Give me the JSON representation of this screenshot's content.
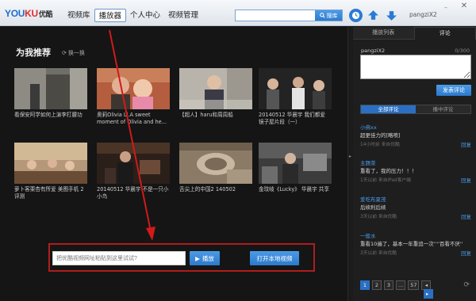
{
  "logo": {
    "you": "YOU",
    "ku": "KU",
    "cn": "优酷"
  },
  "nav": [
    "视频库",
    "播放器",
    "个人中心",
    "视频管理"
  ],
  "search": {
    "placeholder": "",
    "button": "搜库"
  },
  "user": {
    "name": "pangziX2"
  },
  "section": {
    "title": "为我推荐",
    "refresh": "换一换"
  },
  "videos": [
    {
      "title": "看保安阿学如何上演李打腰功"
    },
    {
      "title": "奥莉Olivia Li.A sweet moment of Olivia and he..."
    },
    {
      "title": "【超人】haru和周周船"
    },
    {
      "title": "20140512 华晨宇 我们都爱 镜子屋片段（一）"
    },
    {
      "title": "萝卜客栗杏有所爱 美图手机 2评测"
    },
    {
      "title": "20140512 华晨宇 不是一只小 小鸟"
    },
    {
      "title": "舌尖上的中国2 140502"
    },
    {
      "title": "金玟岐《Lucky》 华晨宇 共享"
    }
  ],
  "player": {
    "url_placeholder": "把优酷视频网址粘贴到这里试试?",
    "play": "播放",
    "local": "打开本地视频"
  },
  "panel": {
    "tabs": [
      "播放列表",
      "评论"
    ],
    "comment_user": "pangziX2",
    "char_count": "0/300",
    "submit": "发表评论",
    "filter_tabs": [
      "全部评论",
      "播中评论"
    ],
    "comments": [
      {
        "user": "小佛xx",
        "body": "超更佳力的[略喷]",
        "meta": "14小时前 来自优酷",
        "reply": "回复"
      },
      {
        "user": "主題菜",
        "body": "重看了，我的压力！！！",
        "meta": "1天以前 来自iPad客户端",
        "reply": "回复"
      },
      {
        "user": "爱吃布夏茂",
        "body": "后续利后续",
        "meta": "3天以前 来自优酷",
        "reply": "回复"
      },
      {
        "user": "一般水",
        "body": "重看10遍了，基本一年重追一次''''百看不厌''",
        "meta": "3天以前 来自优酷",
        "reply": "回复"
      }
    ],
    "pages": [
      "1",
      "2",
      "3",
      "...",
      "57"
    ]
  },
  "colors": {
    "accent": "#2a6fc4",
    "highlight": "#b01d1d"
  }
}
